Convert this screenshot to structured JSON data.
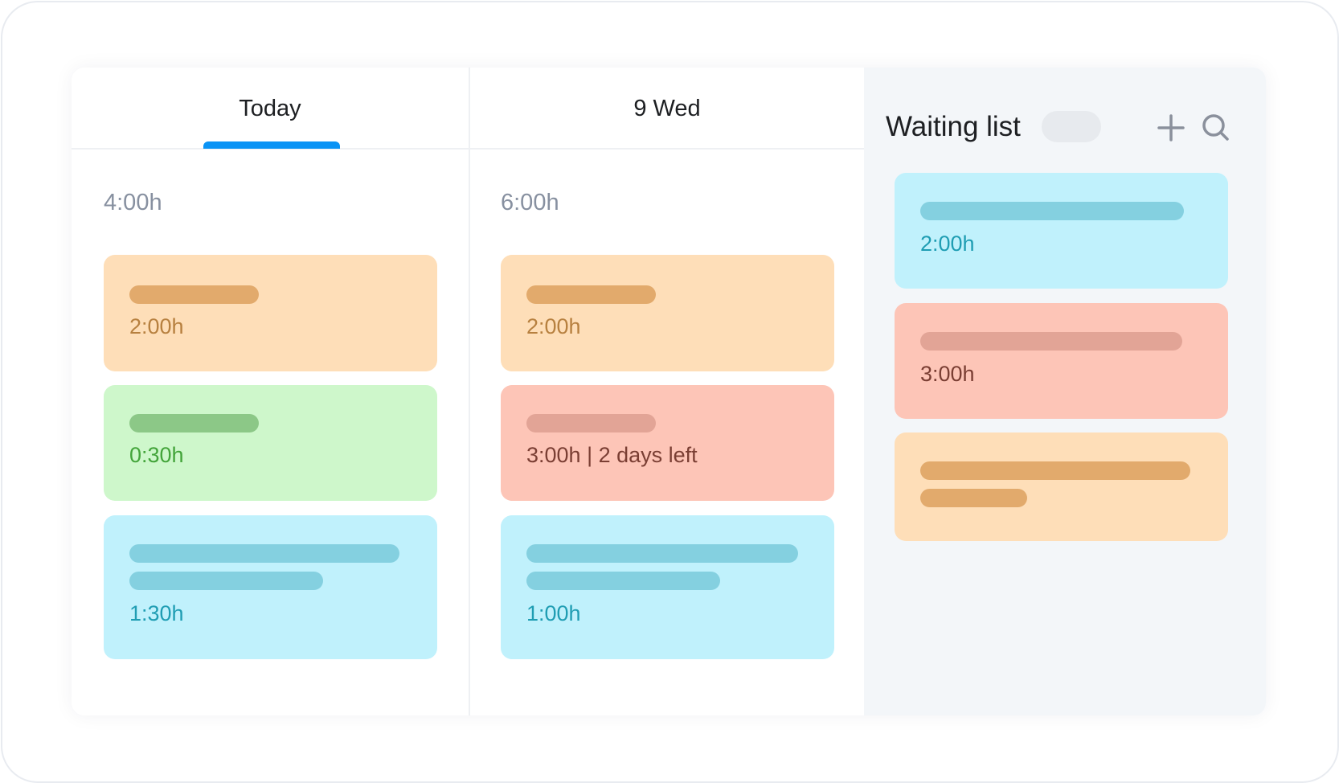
{
  "columns": [
    {
      "title": "Today",
      "active": true,
      "total": "4:00h",
      "cards": [
        {
          "color": "orange",
          "time": "2:00h"
        },
        {
          "color": "green",
          "time": "0:30h"
        },
        {
          "color": "blue",
          "time": "1:30h"
        }
      ]
    },
    {
      "title": "9 Wed",
      "active": false,
      "total": "6:00h",
      "cards": [
        {
          "color": "orange",
          "time": "2:00h"
        },
        {
          "color": "red",
          "time": "3:00h | 2 days left"
        },
        {
          "color": "blue",
          "time": "1:00h"
        }
      ]
    }
  ],
  "waiting_list": {
    "title": "Waiting list",
    "add_icon": "plus-icon",
    "search_icon": "search-icon",
    "cards": [
      {
        "color": "blue",
        "time": "2:00h"
      },
      {
        "color": "red",
        "time": "3:00h"
      },
      {
        "color": "orange",
        "time": ""
      }
    ]
  },
  "colors": {
    "accent": "#0a93f5",
    "orange_card": "#fedeb8",
    "green_card": "#cef7cb",
    "blue_card": "#c0f1fc",
    "red_card": "#fdc5b7"
  }
}
